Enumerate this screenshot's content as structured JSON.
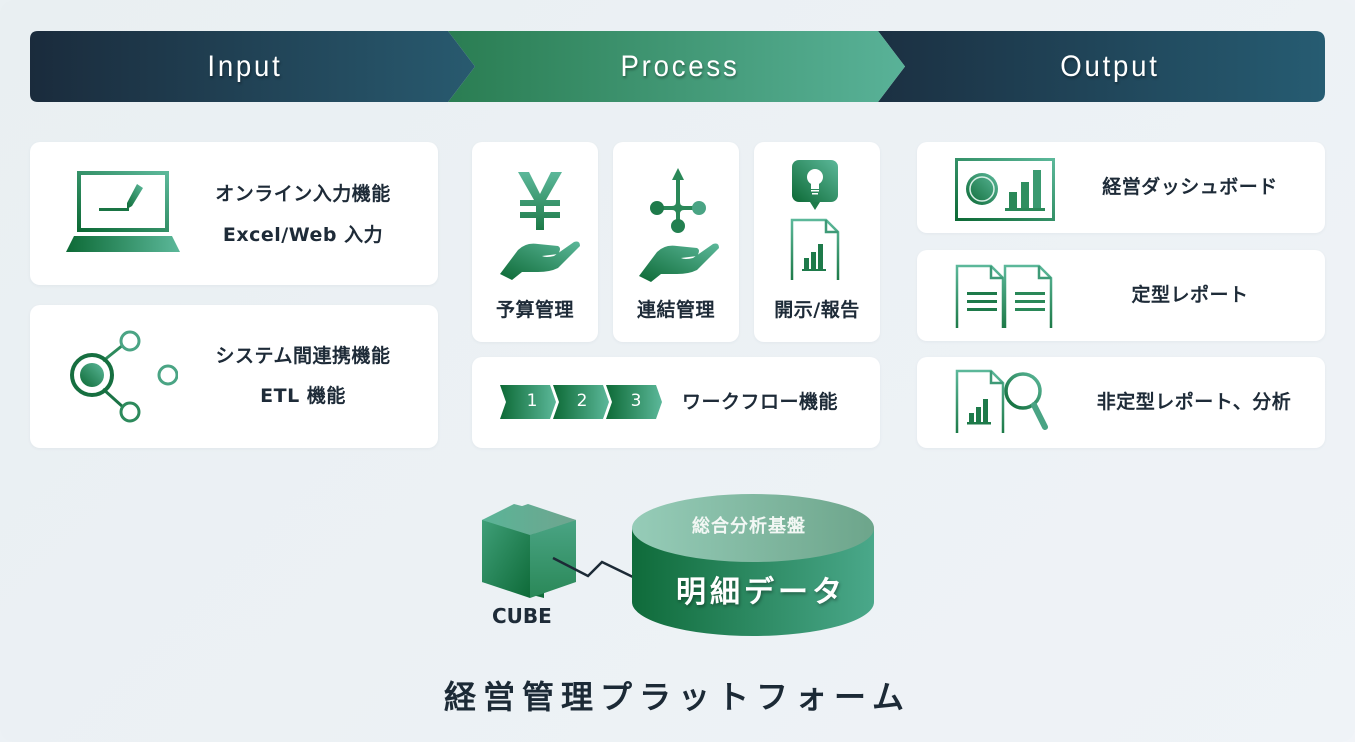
{
  "banner": {
    "stages": [
      {
        "label": "Input"
      },
      {
        "label": "Process"
      },
      {
        "label": "Output"
      }
    ]
  },
  "colors": {
    "navy_dark": "#1b2e40",
    "navy_light": "#265a70",
    "green_dark": "#0f6b3a",
    "green_light": "#5ab497",
    "text_dark": "#1e2b38",
    "background": "#eaf0f3"
  },
  "input": {
    "cards": [
      {
        "icon": "laptop-pen-icon",
        "lines": [
          "オンライン入力機能",
          "Excel/Web 入力"
        ]
      },
      {
        "icon": "network-hub-icon",
        "lines": [
          "システム間連携機能",
          "ETL 機能"
        ]
      }
    ]
  },
  "process": {
    "tiles": [
      {
        "icon": "yen-hand-icon",
        "label": "予算管理"
      },
      {
        "icon": "consolidation-hand-icon",
        "label": "連結管理"
      },
      {
        "icon": "idea-report-icon",
        "label": "開示/報告"
      }
    ],
    "workflow": {
      "steps": [
        "1",
        "2",
        "3"
      ],
      "label": "ワークフロー機能"
    }
  },
  "output": {
    "cards": [
      {
        "icon": "dashboard-icon",
        "label": "経営ダッシュボード"
      },
      {
        "icon": "documents-icon",
        "label": "定型レポート"
      },
      {
        "icon": "report-search-icon",
        "label": "非定型レポート、分析"
      }
    ]
  },
  "platform": {
    "cube_label": "CUBE",
    "database_top_label": "総合分析基盤",
    "database_main_label": "明細データ",
    "title": "経営管理プラットフォーム"
  }
}
